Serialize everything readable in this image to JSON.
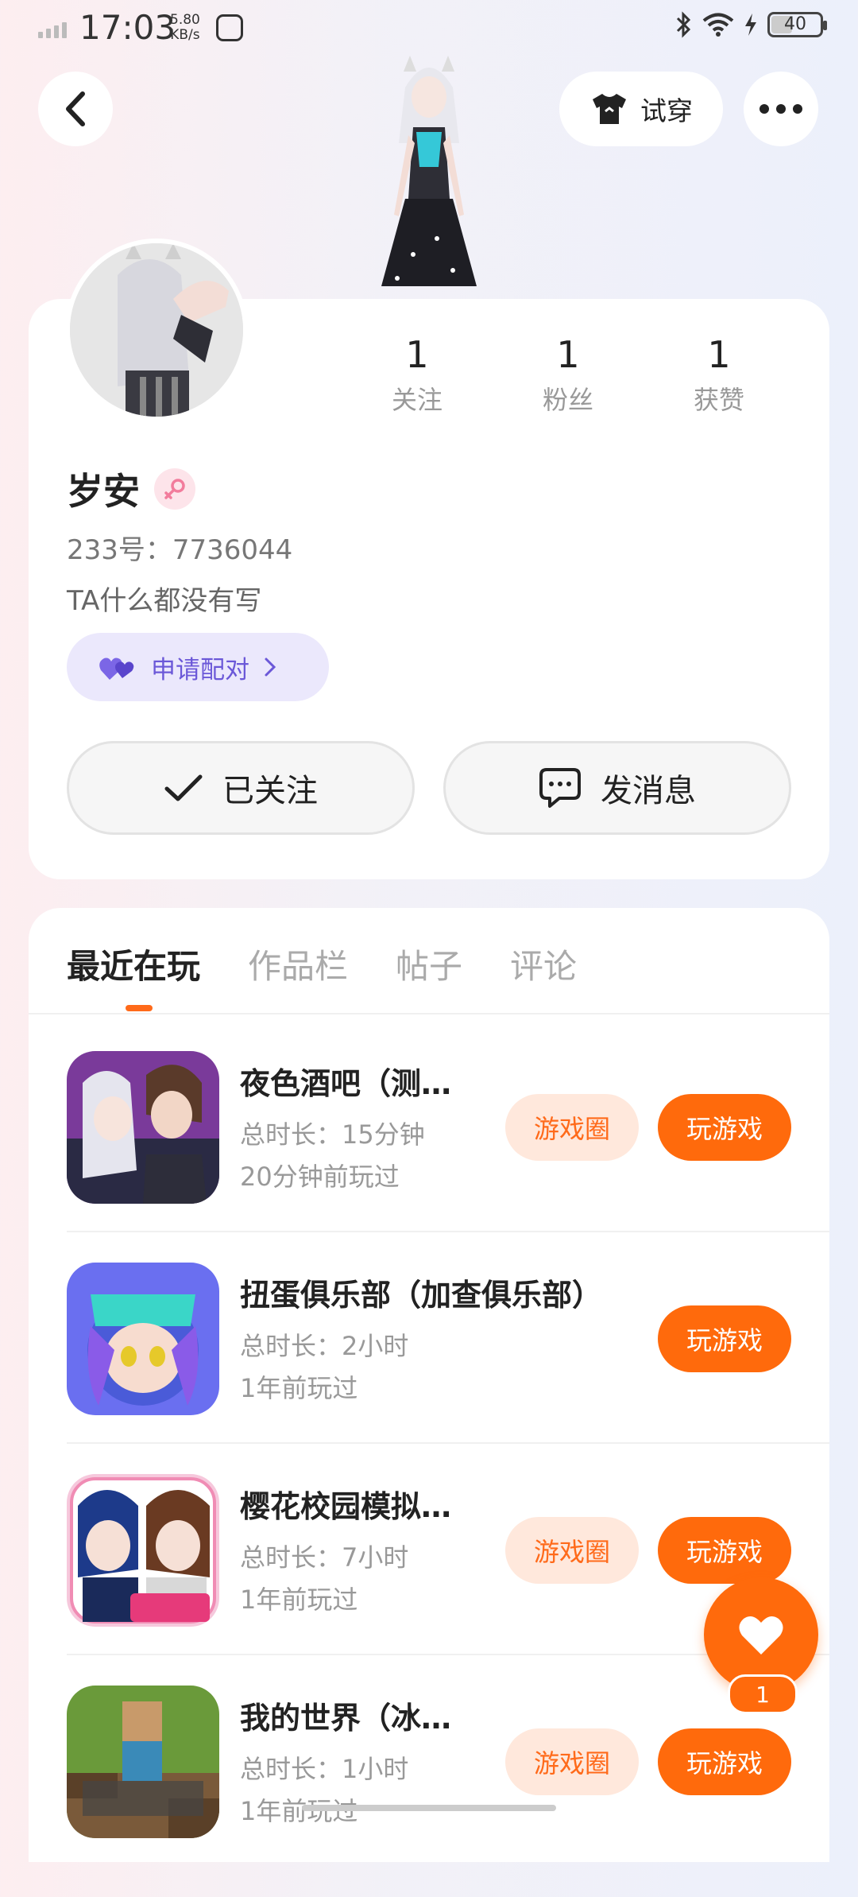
{
  "status_bar": {
    "time": "17:03",
    "net_speed_value": "5.80",
    "net_speed_unit": "KB/s",
    "battery": "40"
  },
  "header": {
    "try_on_label": "试穿"
  },
  "profile": {
    "name": "岁安",
    "uid": "233号：7736044",
    "bio": "TA什么都没有写",
    "match_label": "申请配对",
    "stats": [
      {
        "value": "1",
        "label": "关注"
      },
      {
        "value": "1",
        "label": "粉丝"
      },
      {
        "value": "1",
        "label": "获赞"
      }
    ],
    "follow_label": "已关注",
    "message_label": "发消息"
  },
  "tabs": [
    {
      "label": "最近在玩",
      "active": true
    },
    {
      "label": "作品栏",
      "active": false
    },
    {
      "label": "帖子",
      "active": false
    },
    {
      "label": "评论",
      "active": false
    }
  ],
  "games": [
    {
      "title": "夜色酒吧（测…",
      "duration": "总时长：15分钟",
      "last_played": "20分钟前玩过",
      "circle_label": "游戏圈",
      "play_label": "玩游戏"
    },
    {
      "title": "扭蛋俱乐部（加查俱乐部）",
      "duration": "总时长：2小时",
      "last_played": "1年前玩过",
      "play_label": "玩游戏"
    },
    {
      "title": "樱花校园模拟…",
      "duration": "总时长：7小时",
      "last_played": "1年前玩过",
      "circle_label": "游戏圈",
      "play_label": "玩游戏"
    },
    {
      "title": "我的世界（冰…",
      "duration": "总时长：1小时",
      "last_played": "1年前玩过",
      "circle_label": "游戏圈",
      "play_label": "玩游戏"
    }
  ],
  "like": {
    "count": "1"
  },
  "colors": {
    "accent": "#ff6a0c",
    "match": "#6b58d8"
  }
}
